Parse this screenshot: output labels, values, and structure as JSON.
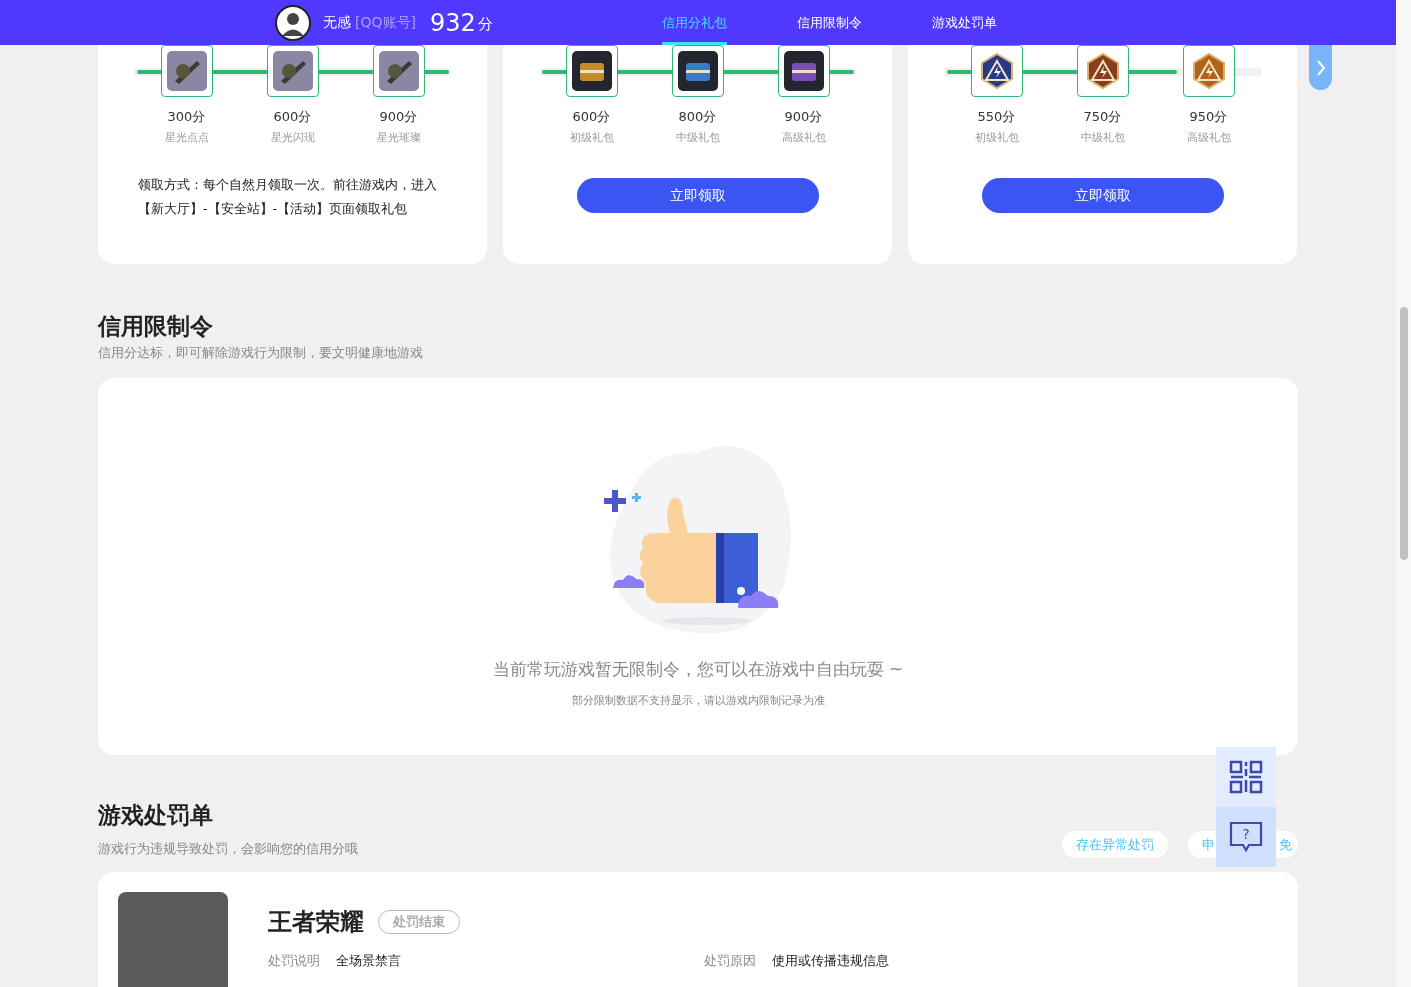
{
  "header": {
    "user_name": "无感",
    "account_type": "[QQ账号]",
    "score": "932",
    "score_unit": "分",
    "tabs": [
      {
        "label": "信用分礼包",
        "selected": true
      },
      {
        "label": "信用限制令",
        "selected": false
      },
      {
        "label": "游戏处罚单",
        "selected": false
      }
    ]
  },
  "gift_cards": [
    {
      "kind": "info",
      "level": 1,
      "tiers": [
        {
          "score": "300分",
          "name": "星光点点"
        },
        {
          "score": "600分",
          "name": "星光闪现"
        },
        {
          "score": "900分",
          "name": "星光璀璨"
        }
      ],
      "description": "领取方式：每个自然月领取一次。前往游戏内，进入【新大厅】-【安全站】-【活动】页面领取礼包"
    },
    {
      "kind": "claim",
      "level": 1,
      "tiers": [
        {
          "score": "600分",
          "name": "初级礼包"
        },
        {
          "score": "800分",
          "name": "中级礼包"
        },
        {
          "score": "900分",
          "name": "高级礼包"
        }
      ],
      "button": "立即领取"
    },
    {
      "kind": "claim",
      "level": 0.74,
      "tiers": [
        {
          "score": "550分",
          "name": "初级礼包"
        },
        {
          "score": "750分",
          "name": "中级礼包"
        },
        {
          "score": "950分",
          "name": "高级礼包"
        }
      ],
      "button": "立即领取"
    }
  ],
  "restrictions": {
    "title": "信用限制令",
    "subtitle": "信用分达标，即可解除游戏行为限制，要文明健康地游戏",
    "empty_message": "当前常玩游戏暂无限制令，您可以在游戏中自由玩耍 ~",
    "note": "部分限制数据不支持显示，请以游戏内限制记录为准"
  },
  "penalties": {
    "title": "游戏处罚单",
    "subtitle": "游戏行为违规导致处罚，会影响您的信用分哦",
    "actions": [
      {
        "kind": "full",
        "label": "存在异常处罚"
      },
      {
        "kind": "covered",
        "label_start": "申",
        "label_end": "免"
      }
    ],
    "help_glyph": "?",
    "items": [
      {
        "game": "王者荣耀",
        "status": "处罚结束",
        "fields": [
          {
            "label": "处罚说明",
            "value": "全场景禁言"
          },
          {
            "label": "处罚原因",
            "value": "使用或传播违规信息"
          }
        ]
      }
    ]
  }
}
